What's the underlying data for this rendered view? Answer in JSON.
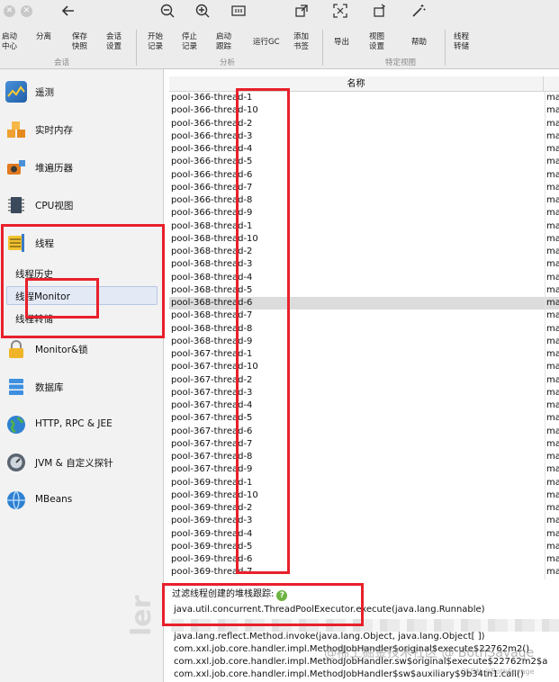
{
  "colors": {
    "annotation_red": "#e8202b",
    "selected_row": "#dcdcdc",
    "sidebar_bg": "#f2f2f2",
    "toolbar_bg": "#ececec",
    "help_green": "#6cb33f"
  },
  "window": {
    "icons": [
      "back-arrow-icon",
      "zoom-out-icon",
      "zoom-in-icon",
      "fit-width-icon",
      "export-view-icon",
      "screenshot-icon",
      "rotate-icon",
      "magic-wand-icon"
    ]
  },
  "toolbar": {
    "buttons": [
      {
        "label": "启动\n中心"
      },
      {
        "label": "分离"
      },
      {
        "label": "保存\n快照"
      },
      {
        "label": "会话\n设置"
      },
      {
        "label": "开始\n记录"
      },
      {
        "label": "停止\n记录"
      },
      {
        "label": "启动\n跟踪"
      },
      {
        "label": "运行GC"
      },
      {
        "label": "添加\n书签"
      },
      {
        "label": "导出"
      },
      {
        "label": "视图\n设置"
      },
      {
        "label": "帮助"
      },
      {
        "label": "线程\n转储"
      }
    ],
    "groups": {
      "session": "会话",
      "analysis": "分析",
      "view": "特定视图"
    }
  },
  "sidebar": {
    "items": [
      {
        "label": "遥测",
        "icon": "telemetry-icon"
      },
      {
        "label": "实时内存",
        "icon": "live-memory-icon"
      },
      {
        "label": "堆遍历器",
        "icon": "heap-walker-icon"
      },
      {
        "label": "CPU视图",
        "icon": "cpu-views-icon"
      },
      {
        "label": "线程",
        "icon": "threads-icon"
      },
      {
        "label": "Monitor&锁",
        "icon": "monitor-lock-icon"
      },
      {
        "label": "数据库",
        "icon": "database-icon"
      },
      {
        "label": "HTTP, RPC & JEE",
        "icon": "http-globe-icon"
      },
      {
        "label": "JVM & 自定义探针",
        "icon": "jvm-probe-icon"
      },
      {
        "label": "MBeans",
        "icon": "mbeans-globe-icon"
      }
    ],
    "thread_subitems": [
      {
        "label": "线程历史"
      },
      {
        "label": "线程Monitor"
      },
      {
        "label": "线程转储"
      }
    ],
    "selected_subitem": "线程Monitor"
  },
  "thread_table": {
    "columns": [
      "名称",
      "ma"
    ],
    "selected_row": "pool-368-thread-6",
    "rows": [
      {
        "name": "pool-366-thread-1",
        "col2": "ma"
      },
      {
        "name": "pool-366-thread-10",
        "col2": "ma"
      },
      {
        "name": "pool-366-thread-2",
        "col2": "ma"
      },
      {
        "name": "pool-366-thread-3",
        "col2": "ma"
      },
      {
        "name": "pool-366-thread-4",
        "col2": "ma"
      },
      {
        "name": "pool-366-thread-5",
        "col2": "ma"
      },
      {
        "name": "pool-366-thread-6",
        "col2": "ma"
      },
      {
        "name": "pool-366-thread-7",
        "col2": "ma"
      },
      {
        "name": "pool-366-thread-8",
        "col2": "ma"
      },
      {
        "name": "pool-366-thread-9",
        "col2": "ma"
      },
      {
        "name": "pool-368-thread-1",
        "col2": "ma"
      },
      {
        "name": "pool-368-thread-10",
        "col2": "ma"
      },
      {
        "name": "pool-368-thread-2",
        "col2": "ma"
      },
      {
        "name": "pool-368-thread-3",
        "col2": "ma"
      },
      {
        "name": "pool-368-thread-4",
        "col2": "ma"
      },
      {
        "name": "pool-368-thread-5",
        "col2": "ma"
      },
      {
        "name": "pool-368-thread-6",
        "col2": "ma"
      },
      {
        "name": "pool-368-thread-7",
        "col2": "ma"
      },
      {
        "name": "pool-368-thread-8",
        "col2": "ma"
      },
      {
        "name": "pool-368-thread-9",
        "col2": "ma"
      },
      {
        "name": "pool-367-thread-1",
        "col2": "ma"
      },
      {
        "name": "pool-367-thread-10",
        "col2": "ma"
      },
      {
        "name": "pool-367-thread-2",
        "col2": "ma"
      },
      {
        "name": "pool-367-thread-3",
        "col2": "ma"
      },
      {
        "name": "pool-367-thread-4",
        "col2": "ma"
      },
      {
        "name": "pool-367-thread-5",
        "col2": "ma"
      },
      {
        "name": "pool-367-thread-6",
        "col2": "ma"
      },
      {
        "name": "pool-367-thread-7",
        "col2": "ma"
      },
      {
        "name": "pool-367-thread-8",
        "col2": "ma"
      },
      {
        "name": "pool-367-thread-9",
        "col2": "ma"
      },
      {
        "name": "pool-369-thread-1",
        "col2": "ma"
      },
      {
        "name": "pool-369-thread-10",
        "col2": "ma"
      },
      {
        "name": "pool-369-thread-2",
        "col2": "ma"
      },
      {
        "name": "pool-369-thread-3",
        "col2": "ma"
      },
      {
        "name": "pool-369-thread-4",
        "col2": "ma"
      },
      {
        "name": "pool-369-thread-5",
        "col2": "ma"
      },
      {
        "name": "pool-369-thread-6",
        "col2": "ma"
      },
      {
        "name": "pool-369-thread-7",
        "col2": "ma"
      }
    ]
  },
  "stack_trace": {
    "title": "过滤线程创建的堆栈跟踪:",
    "lines": [
      "java.util.concurrent.ThreadPoolExecutor.execute(java.lang.Runnable)",
      "java.lang.reflect.Method.invoke(java.lang.Object, java.lang.Object[ ])",
      "com.xxl.job.core.handler.impl.MethodJobHandler$original$execute$22762m2()",
      "com.xxl.job.core.handler.impl.MethodJobHandler.sw$original$execute$22762m2$a",
      "com.xxl.job.core.handler.impl.MethodJobHandler$sw$auxiliary$9b34tn1.call()"
    ]
  },
  "watermarks": {
    "main": "@稀土掘金技术社区 @ BothSavage",
    "csdn": "CSDN @BothSavage",
    "side": "ler"
  }
}
